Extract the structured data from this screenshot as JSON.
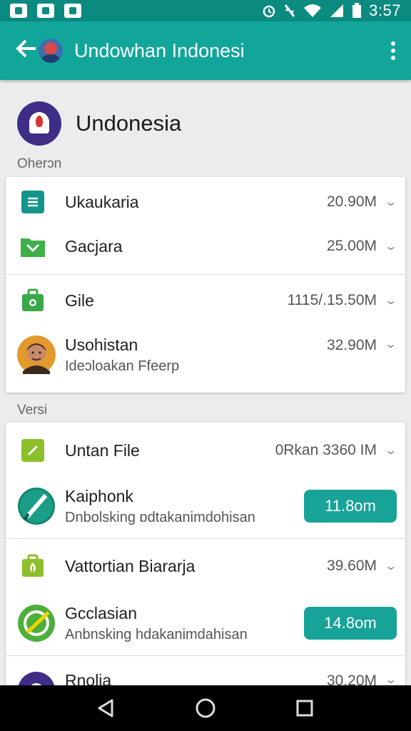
{
  "status_bar": {
    "time": "3:57",
    "left_icons": [
      "gallery-icon",
      "photo-icon",
      "photo-icon"
    ],
    "right_icons": [
      "alarm-icon",
      "vibrate-off-icon",
      "wifi-icon",
      "signal-icon",
      "battery-icon"
    ]
  },
  "app_bar": {
    "title": "Undowhan Indonesi",
    "back_icon": "back-arrow-icon",
    "menu_icon": "overflow-menu-icon"
  },
  "header": {
    "title": "Undonesia"
  },
  "sections": [
    {
      "label": "Oherɔn",
      "items": [
        {
          "title": "Ukaukaria",
          "size": "20.90M",
          "icon": "list-icon",
          "color": "#14958a"
        },
        {
          "title": "Gacjara",
          "size": "25.00M",
          "icon": "folder-icon",
          "color": "#3db04a"
        },
        {
          "title": "Gile",
          "size": "1115/.15.50M",
          "icon": "briefcase-icon",
          "color": "#3aa848"
        },
        {
          "title": "Usohistan",
          "subtitle": "Ideɔloakan Ffeerp",
          "size": "32.90M",
          "icon": "person-photo-icon"
        }
      ]
    },
    {
      "label": "Versi",
      "items": [
        {
          "title": "Untan File",
          "size": "0Rkan 3360 IM",
          "icon": "edit-icon",
          "color": "#8cbf2a"
        },
        {
          "title": "Kaiphonk",
          "subtitle": "Dnbolsking ɒdtakanimdohisan",
          "button": "11.8om",
          "icon": "pen-circle-icon"
        },
        {
          "title": "Vattortian Biararja",
          "size": "39.60M",
          "icon": "leaf-bag-icon",
          "color": "#8cbf2a"
        },
        {
          "title": "Gcclasian",
          "subtitle": "Anbnsking hdakanimdahisan",
          "button": "14.8om",
          "icon": "check-circle-icon"
        },
        {
          "title": "Rnolia",
          "size": "30.20M",
          "icon": "app-circle-icon"
        }
      ]
    }
  ],
  "nav_bar": {
    "icons": [
      "back-triangle-icon",
      "home-circle-icon",
      "recents-square-icon"
    ]
  }
}
